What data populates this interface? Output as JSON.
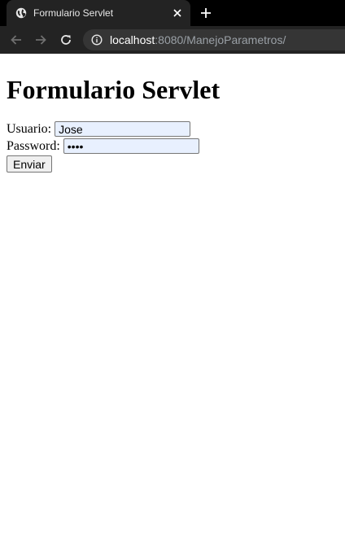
{
  "browser": {
    "tab_title": "Formulario Servlet",
    "url_host": "localhost",
    "url_rest": ":8080/ManejoParametros/",
    "icons": {
      "favicon": "globe-icon",
      "close": "close-icon",
      "new_tab": "plus-icon",
      "back": "back-arrow-icon",
      "forward": "forward-arrow-icon",
      "reload": "reload-icon",
      "site_info": "info-icon"
    }
  },
  "page": {
    "heading": "Formulario Servlet",
    "form": {
      "usuario_label": "Usuario:",
      "usuario_value": "Jose",
      "password_label": "Password:",
      "password_value": "pass",
      "submit_label": "Enviar"
    }
  },
  "colors": {
    "chrome_bg": "#000000",
    "toolbar_bg": "#232323",
    "autofill_bg": "#e8f0fe"
  }
}
